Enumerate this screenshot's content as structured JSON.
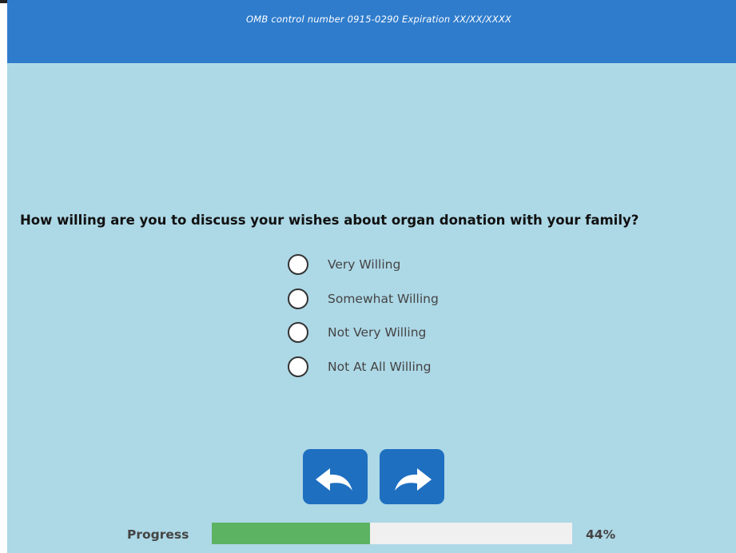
{
  "header": {
    "omb_text": "OMB control number 0915-0290 Expiration XX/XX/XXXX"
  },
  "question": {
    "text": "How willing are you to discuss your wishes about organ donation with your family?"
  },
  "options": [
    {
      "label": "Very Willing"
    },
    {
      "label": "Somewhat Willing"
    },
    {
      "label": "Not Very Willing"
    },
    {
      "label": "Not At All Willing"
    }
  ],
  "navigation": {
    "back_icon": "back-arrow-icon",
    "next_icon": "forward-arrow-icon"
  },
  "progress": {
    "label": "Progress",
    "percent_text": "44%",
    "value": 0.44
  },
  "colors": {
    "background": "#add8e6",
    "header": "#2f7ccc",
    "button": "#1e6fc0",
    "progress_fill": "#5cb362",
    "progress_track": "#f0f0f0"
  }
}
